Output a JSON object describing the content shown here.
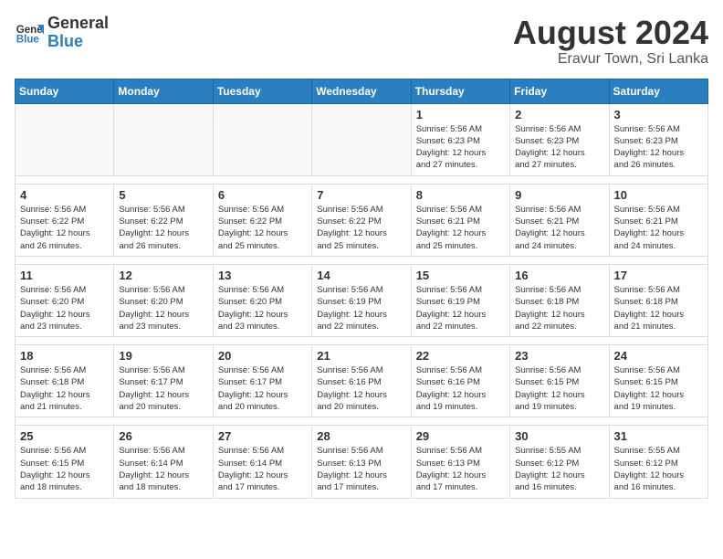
{
  "logo": {
    "line1": "General",
    "line2": "Blue"
  },
  "title": "August 2024",
  "subtitle": "Eravur Town, Sri Lanka",
  "weekdays": [
    "Sunday",
    "Monday",
    "Tuesday",
    "Wednesday",
    "Thursday",
    "Friday",
    "Saturday"
  ],
  "weeks": [
    [
      {
        "day": "",
        "info": ""
      },
      {
        "day": "",
        "info": ""
      },
      {
        "day": "",
        "info": ""
      },
      {
        "day": "",
        "info": ""
      },
      {
        "day": "1",
        "info": "Sunrise: 5:56 AM\nSunset: 6:23 PM\nDaylight: 12 hours\nand 27 minutes."
      },
      {
        "day": "2",
        "info": "Sunrise: 5:56 AM\nSunset: 6:23 PM\nDaylight: 12 hours\nand 27 minutes."
      },
      {
        "day": "3",
        "info": "Sunrise: 5:56 AM\nSunset: 6:23 PM\nDaylight: 12 hours\nand 26 minutes."
      }
    ],
    [
      {
        "day": "4",
        "info": "Sunrise: 5:56 AM\nSunset: 6:22 PM\nDaylight: 12 hours\nand 26 minutes."
      },
      {
        "day": "5",
        "info": "Sunrise: 5:56 AM\nSunset: 6:22 PM\nDaylight: 12 hours\nand 26 minutes."
      },
      {
        "day": "6",
        "info": "Sunrise: 5:56 AM\nSunset: 6:22 PM\nDaylight: 12 hours\nand 25 minutes."
      },
      {
        "day": "7",
        "info": "Sunrise: 5:56 AM\nSunset: 6:22 PM\nDaylight: 12 hours\nand 25 minutes."
      },
      {
        "day": "8",
        "info": "Sunrise: 5:56 AM\nSunset: 6:21 PM\nDaylight: 12 hours\nand 25 minutes."
      },
      {
        "day": "9",
        "info": "Sunrise: 5:56 AM\nSunset: 6:21 PM\nDaylight: 12 hours\nand 24 minutes."
      },
      {
        "day": "10",
        "info": "Sunrise: 5:56 AM\nSunset: 6:21 PM\nDaylight: 12 hours\nand 24 minutes."
      }
    ],
    [
      {
        "day": "11",
        "info": "Sunrise: 5:56 AM\nSunset: 6:20 PM\nDaylight: 12 hours\nand 23 minutes."
      },
      {
        "day": "12",
        "info": "Sunrise: 5:56 AM\nSunset: 6:20 PM\nDaylight: 12 hours\nand 23 minutes."
      },
      {
        "day": "13",
        "info": "Sunrise: 5:56 AM\nSunset: 6:20 PM\nDaylight: 12 hours\nand 23 minutes."
      },
      {
        "day": "14",
        "info": "Sunrise: 5:56 AM\nSunset: 6:19 PM\nDaylight: 12 hours\nand 22 minutes."
      },
      {
        "day": "15",
        "info": "Sunrise: 5:56 AM\nSunset: 6:19 PM\nDaylight: 12 hours\nand 22 minutes."
      },
      {
        "day": "16",
        "info": "Sunrise: 5:56 AM\nSunset: 6:18 PM\nDaylight: 12 hours\nand 22 minutes."
      },
      {
        "day": "17",
        "info": "Sunrise: 5:56 AM\nSunset: 6:18 PM\nDaylight: 12 hours\nand 21 minutes."
      }
    ],
    [
      {
        "day": "18",
        "info": "Sunrise: 5:56 AM\nSunset: 6:18 PM\nDaylight: 12 hours\nand 21 minutes."
      },
      {
        "day": "19",
        "info": "Sunrise: 5:56 AM\nSunset: 6:17 PM\nDaylight: 12 hours\nand 20 minutes."
      },
      {
        "day": "20",
        "info": "Sunrise: 5:56 AM\nSunset: 6:17 PM\nDaylight: 12 hours\nand 20 minutes."
      },
      {
        "day": "21",
        "info": "Sunrise: 5:56 AM\nSunset: 6:16 PM\nDaylight: 12 hours\nand 20 minutes."
      },
      {
        "day": "22",
        "info": "Sunrise: 5:56 AM\nSunset: 6:16 PM\nDaylight: 12 hours\nand 19 minutes."
      },
      {
        "day": "23",
        "info": "Sunrise: 5:56 AM\nSunset: 6:15 PM\nDaylight: 12 hours\nand 19 minutes."
      },
      {
        "day": "24",
        "info": "Sunrise: 5:56 AM\nSunset: 6:15 PM\nDaylight: 12 hours\nand 19 minutes."
      }
    ],
    [
      {
        "day": "25",
        "info": "Sunrise: 5:56 AM\nSunset: 6:15 PM\nDaylight: 12 hours\nand 18 minutes."
      },
      {
        "day": "26",
        "info": "Sunrise: 5:56 AM\nSunset: 6:14 PM\nDaylight: 12 hours\nand 18 minutes."
      },
      {
        "day": "27",
        "info": "Sunrise: 5:56 AM\nSunset: 6:14 PM\nDaylight: 12 hours\nand 17 minutes."
      },
      {
        "day": "28",
        "info": "Sunrise: 5:56 AM\nSunset: 6:13 PM\nDaylight: 12 hours\nand 17 minutes."
      },
      {
        "day": "29",
        "info": "Sunrise: 5:56 AM\nSunset: 6:13 PM\nDaylight: 12 hours\nand 17 minutes."
      },
      {
        "day": "30",
        "info": "Sunrise: 5:55 AM\nSunset: 6:12 PM\nDaylight: 12 hours\nand 16 minutes."
      },
      {
        "day": "31",
        "info": "Sunrise: 5:55 AM\nSunset: 6:12 PM\nDaylight: 12 hours\nand 16 minutes."
      }
    ]
  ]
}
